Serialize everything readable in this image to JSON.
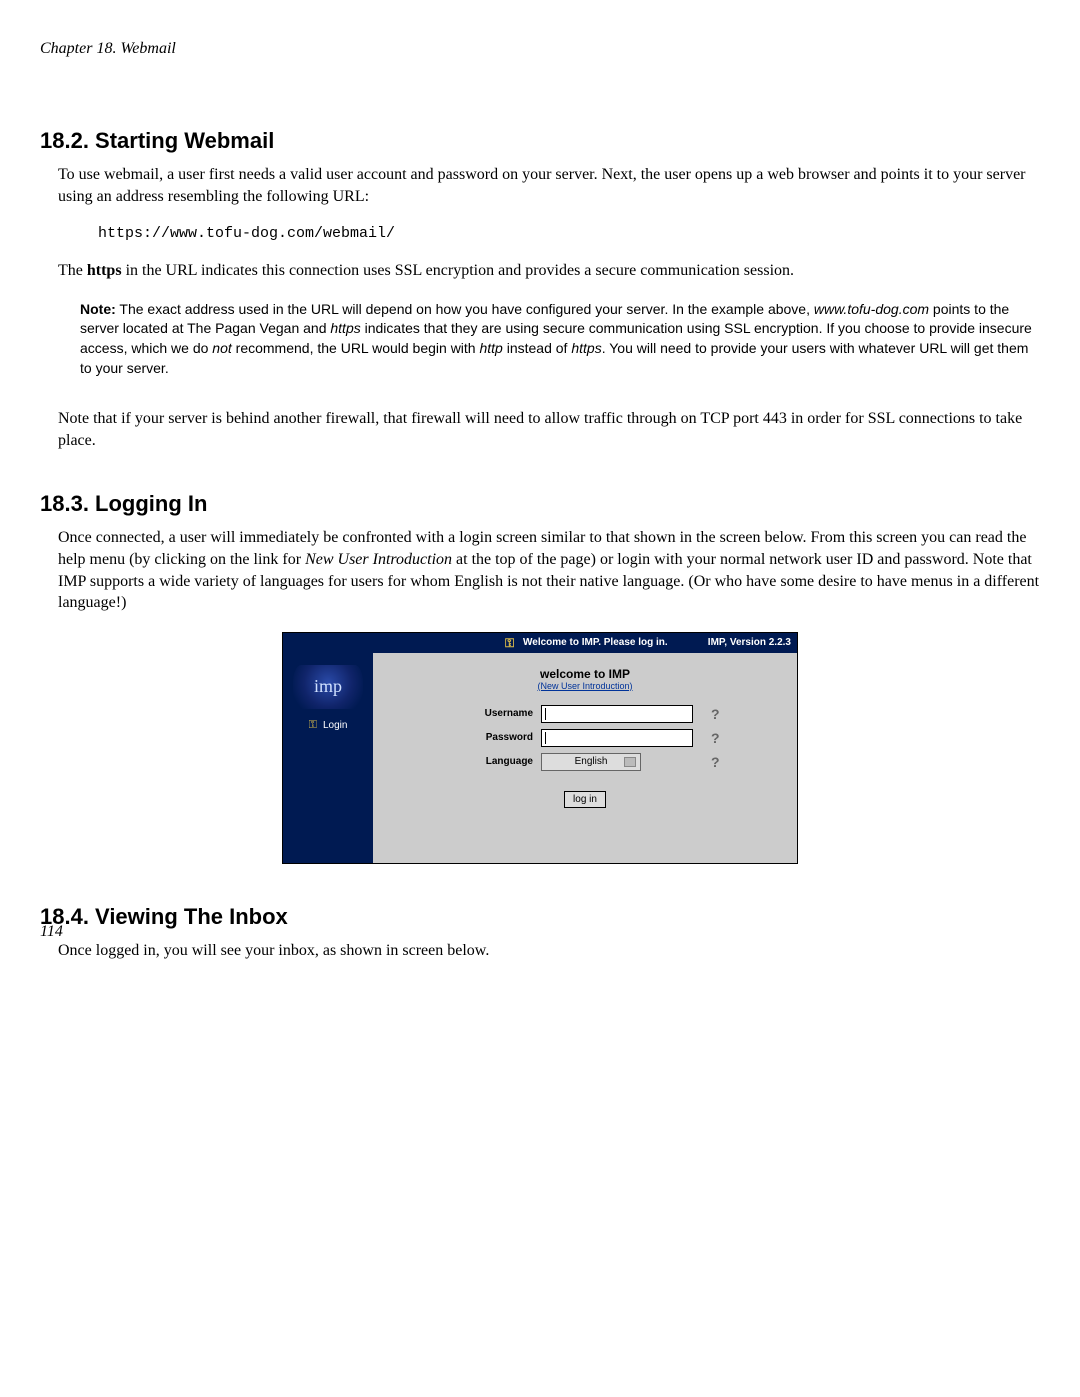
{
  "chapter_header": "Chapter 18. Webmail",
  "section_182": {
    "title": "18.2. Starting Webmail",
    "p1": "To use webmail, a user first needs a valid user account and password on your server. Next, the user opens up a web browser and points it to your server using an address resembling the following URL:",
    "code": "https://www.tofu-dog.com/webmail/",
    "p2a": "The ",
    "p2b": "https",
    "p2c": " in the URL indicates this connection uses SSL encryption and provides a secure communication session.",
    "note_label": "Note:",
    "note_1": " The exact address used in the URL will depend on how you have configured your server. In the example above, ",
    "note_domain": "www.tofu-dog.com",
    "note_2": " points to the server located at The Pagan Vegan and ",
    "note_https": "https",
    "note_3": " indicates that they are using secure communication using SSL encryption. If you choose to provide insecure access, which we do ",
    "note_not": "not",
    "note_4": " recommend, the URL would begin with ",
    "note_http": "http",
    "note_5": " instead of ",
    "note_https2": "https",
    "note_6": ". You will need to provide your users with whatever URL will get them to your server.",
    "p3": "Note that if your server is behind another firewall, that firewall will need to allow traffic through on TCP port 443 in order for SSL connections to take place."
  },
  "section_183": {
    "title": "18.3. Logging In",
    "p1a": "Once connected, a user will immediately be confronted with a login screen similar to that shown in the screen below. From this screen you can read the help menu (by clicking on the link for ",
    "p1b": "New User Introduction",
    "p1c": " at the top of the page) or login with your normal network user ID and password. Note that IMP supports a wide variety of languages for users for whom English is not their native language. (Or who have some desire to have menus in a different language!)"
  },
  "screenshot": {
    "top_title": "Welcome to IMP. Please log in.",
    "version": "IMP, Version 2.2.3",
    "logo_text": "imp",
    "sidebar_login": "Login",
    "welcome": "welcome to IMP",
    "new_user_link": "(New User Introduction)",
    "username_label": "Username",
    "password_label": "Password",
    "language_label": "Language",
    "language_value": "English",
    "login_button": "log in",
    "help_glyph": "?"
  },
  "section_184": {
    "title": "18.4. Viewing The Inbox",
    "p1": "Once logged in, you will see your inbox, as shown in screen below."
  },
  "page_number": "114"
}
